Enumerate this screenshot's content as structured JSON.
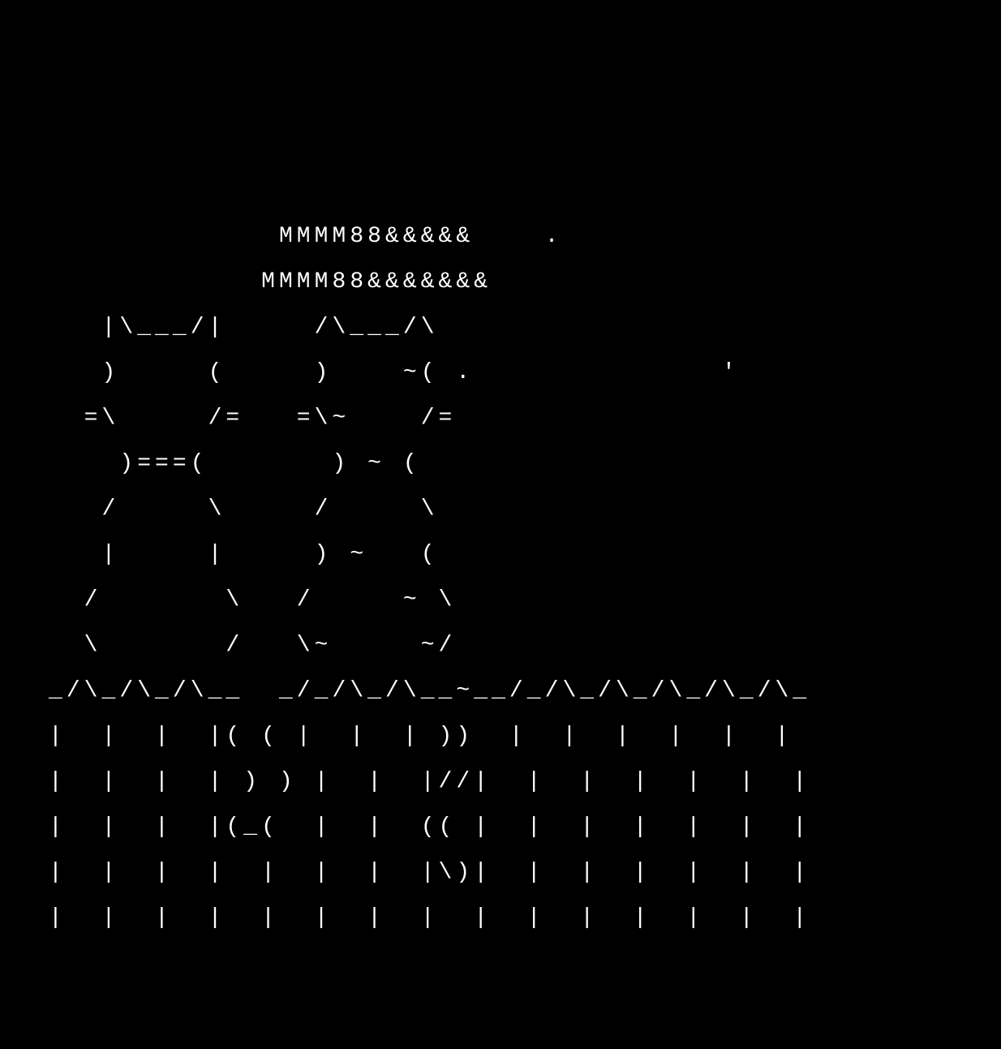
{
  "ascii_art": {
    "description": "Two cats sitting on a fence under clouds (ASCII art)",
    "lines": [
      "",
      "",
      "",
      "",
      "             MMMM88&&&&&    .",
      "            MMMM88&&&&&&&",
      "   |\\___/|     /\\___/\\",
      "   )     (     )    ~( .              '",
      "  =\\     /=   =\\~    /=",
      "    )===(       ) ~ (",
      "   /     \\     /     \\",
      "   |     |     ) ~   (",
      "  /       \\   /     ~ \\",
      "  \\       /   \\~     ~/",
      "_/\\_/\\_/\\__  _/_/\\_/\\__~__/_/\\_/\\_/\\_/\\_/\\_",
      "|  |  |  |( ( |  |  | ))  |  |  |  |  |  |",
      "|  |  |  | ) ) |  |  |//|  |  |  |  |  |  |",
      "|  |  |  |(_(  |  |  (( |  |  |  |  |  |  |",
      "|  |  |  |  |  |  |  |\\)|  |  |  |  |  |  |",
      "|  |  |  |  |  |  |  |  |  |  |  |  |  |  |"
    ]
  }
}
